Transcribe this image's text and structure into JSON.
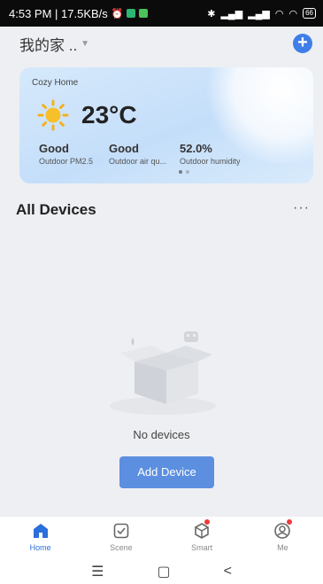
{
  "status_bar": {
    "time_speed": "4:53 PM | 17.5KB/s",
    "battery": "66"
  },
  "header": {
    "home_name": "我的家 ..",
    "add_icon": "plus-circle-icon"
  },
  "weather": {
    "title": "Cozy Home",
    "temperature": "23°C",
    "metrics": [
      {
        "value": "Good",
        "label": "Outdoor PM2.5"
      },
      {
        "value": "Good",
        "label": "Outdoor air qu..."
      },
      {
        "value": "52.0%",
        "label": "Outdoor humidity"
      }
    ],
    "page_count": 2,
    "active_page": 1
  },
  "devices": {
    "section_title": "All Devices",
    "more_label": "···",
    "empty_text": "No devices",
    "add_button": "Add Device"
  },
  "tabs": [
    {
      "label": "Home",
      "icon": "home-icon",
      "active": true
    },
    {
      "label": "Scene",
      "icon": "checkbox-icon",
      "active": false
    },
    {
      "label": "Smart",
      "icon": "cube-icon",
      "active": false
    },
    {
      "label": "Me",
      "icon": "profile-icon",
      "active": false
    }
  ],
  "system_nav": {
    "menu": "☰",
    "home": "▢",
    "back": "<"
  },
  "colors": {
    "accent": "#3f7ee8",
    "button": "#5c8fe0",
    "badge": "#ee3b3b",
    "status_bar": "#0b0b0b"
  }
}
